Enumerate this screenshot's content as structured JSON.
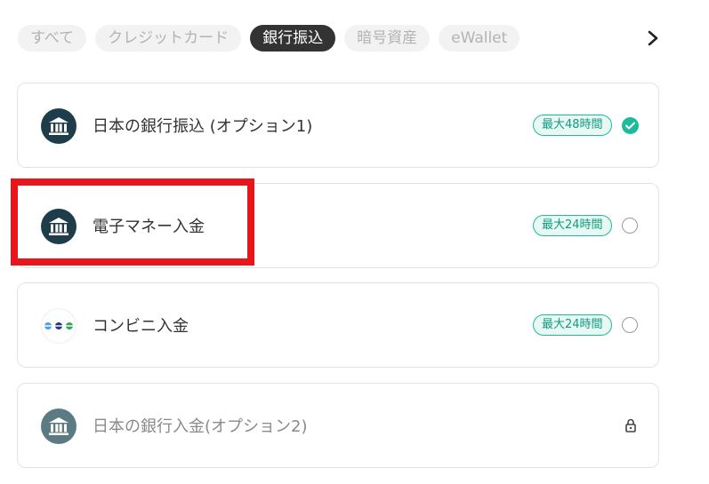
{
  "tabs": [
    {
      "label": "すべて",
      "active": false
    },
    {
      "label": "クレジットカード",
      "active": false
    },
    {
      "label": "銀行振込",
      "active": true
    },
    {
      "label": "暗号資産",
      "active": false
    },
    {
      "label": "eWallet",
      "active": false
    }
  ],
  "icons": {
    "next": "chevron-right-icon",
    "bank": "bank-icon",
    "convenience": "convenience-store-icon",
    "selected": "check-circle-icon",
    "unselected": "radio-circle-icon",
    "locked": "lock-icon"
  },
  "colors": {
    "accent": "#1dbb9c",
    "bank_icon_bg": "#1e3d4a",
    "highlight_border": "#e8161b"
  },
  "methods": [
    {
      "label": "日本の銀行振込 (オプション1)",
      "badge": "最大48時間",
      "state": "selected"
    },
    {
      "label": "電子マネー入金",
      "badge": "最大24時間",
      "state": "unselected"
    },
    {
      "label": "コンビニ入金",
      "badge": "最大24時間",
      "state": "unselected"
    },
    {
      "label": "日本の銀行入金(オプション2)",
      "badge": "",
      "state": "locked"
    }
  ]
}
